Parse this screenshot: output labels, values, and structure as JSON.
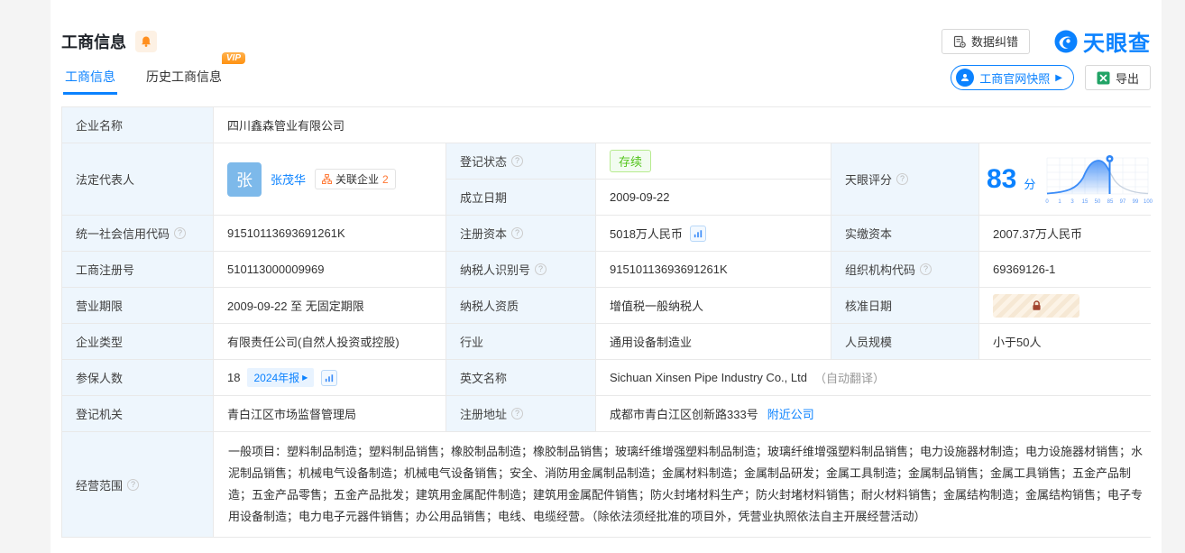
{
  "colors": {
    "accent": "#0b82ff",
    "green": "#52c41a",
    "orange": "#ff8f1f",
    "label_bg": "#eef6fd"
  },
  "header": {
    "title": "工商信息",
    "data_correction": "数据纠错",
    "brand": "天眼查"
  },
  "tabs": {
    "current": "工商信息",
    "history": "历史工商信息",
    "vip": "VIP"
  },
  "toolbar": {
    "snapshot": "工商官网快照",
    "export": "导出"
  },
  "fields": {
    "company_name": {
      "label": "企业名称",
      "value": "四川鑫森管业有限公司"
    },
    "legal_rep": {
      "label": "法定代表人",
      "avatar": "张",
      "name": "张茂华",
      "related_label": "关联企业",
      "related_count": "2"
    },
    "reg_status": {
      "label": "登记状态",
      "value": "存续"
    },
    "establish_date": {
      "label": "成立日期",
      "value": "2009-09-22"
    },
    "score": {
      "label": "天眼评分",
      "value": "83",
      "unit": "分",
      "axis": [
        "0",
        "1",
        "3",
        "15",
        "50",
        "85",
        "97",
        "99",
        "100"
      ]
    },
    "credit_code": {
      "label": "统一社会信用代码",
      "value": "91510113693691261K"
    },
    "reg_capital": {
      "label": "注册资本",
      "value": "5018万人民币"
    },
    "paid_capital": {
      "label": "实缴资本",
      "value": "2007.37万人民币"
    },
    "reg_number": {
      "label": "工商注册号",
      "value": "510113000009969"
    },
    "taxpayer_id": {
      "label": "纳税人识别号",
      "value": "91510113693691261K"
    },
    "org_code": {
      "label": "组织机构代码",
      "value": "69369126-1"
    },
    "business_term": {
      "label": "营业期限",
      "value": "2009-09-22 至 无固定期限"
    },
    "taxpayer_quality": {
      "label": "纳税人资质",
      "value": "增值税一般纳税人"
    },
    "approval_date": {
      "label": "核准日期"
    },
    "company_type": {
      "label": "企业类型",
      "value": "有限责任公司(自然人投资或控股)"
    },
    "industry": {
      "label": "行业",
      "value": "通用设备制造业"
    },
    "staff_size": {
      "label": "人员规模",
      "value": "小于50人"
    },
    "insured": {
      "label": "参保人数",
      "value": "18",
      "badge": "2024年报"
    },
    "english_name": {
      "label": "英文名称",
      "value": "Sichuan Xinsen Pipe Industry Co., Ltd",
      "note": "（自动翻译）"
    },
    "reg_authority": {
      "label": "登记机关",
      "value": "青白江区市场监督管理局"
    },
    "reg_address": {
      "label": "注册地址",
      "value": "成都市青白江区创新路333号",
      "link": "附近公司"
    },
    "business_scope": {
      "label": "经营范围",
      "value": "一般项目：塑料制品制造；塑料制品销售；橡胶制品制造；橡胶制品销售；玻璃纤维增强塑料制品制造；玻璃纤维增强塑料制品销售；电力设施器材制造；电力设施器材销售；水泥制品销售；机械电气设备制造；机械电气设备销售；安全、消防用金属制品制造；金属材料制造；金属制品研发；金属工具制造；金属制品销售；金属工具销售；五金产品制造；五金产品零售；五金产品批发；建筑用金属配件制造；建筑用金属配件销售；防火封堵材料生产；防火封堵材料销售；耐火材料销售；金属结构制造；金属结构销售；电子专用设备制造；电力电子元器件销售；办公用品销售；电线、电缆经营。（除依法须经批准的项目外，凭营业执照依法自主开展经营活动）"
    }
  }
}
